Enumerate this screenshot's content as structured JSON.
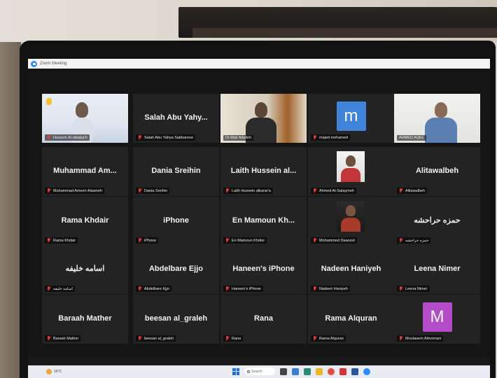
{
  "window": {
    "title": "Zoom Meeting"
  },
  "participants": [
    {
      "id": "p1",
      "label": "Hussein Al rababa'h",
      "video": true,
      "muted": true
    },
    {
      "id": "p2",
      "display": "Salah Abu Yahy...",
      "label": "Salah Abu Yahya Sabbarene",
      "muted": true
    },
    {
      "id": "p3",
      "label": "Dr.Wail Adaileh",
      "video": true,
      "muted": false
    },
    {
      "id": "p4",
      "initial": "m",
      "label": "majed mohamed",
      "muted": true,
      "avatar_color": "#3f84d9"
    },
    {
      "id": "p5",
      "label": "AHMED AQEL",
      "video": true,
      "muted": false,
      "active_speaker": true
    },
    {
      "id": "p6",
      "display": "Muhammad Am...",
      "label": "Muhammad Ameen Alawneh",
      "muted": true
    },
    {
      "id": "p7",
      "display": "Dania Sreihin",
      "label": "Dania Sreihin",
      "muted": true
    },
    {
      "id": "p8",
      "display": "Laith Hussein al...",
      "label": "Laith Hussein alkarar'a",
      "muted": true
    },
    {
      "id": "p9",
      "label": "Ahmed Al-Salaymeh",
      "photo": true,
      "muted": true
    },
    {
      "id": "p10",
      "display": "Alitawalbeh",
      "label": "Alitawalbeh",
      "muted": true
    },
    {
      "id": "p11",
      "display": "Rama Khdair",
      "label": "Rama Khdair",
      "muted": true
    },
    {
      "id": "p12",
      "display": "iPhone",
      "label": "iPhone",
      "muted": true
    },
    {
      "id": "p13",
      "display": "En Mamoun Kh...",
      "label": "En Mamoun Khdier",
      "muted": true
    },
    {
      "id": "p14",
      "label": "Mohammed Dawood",
      "photo": true,
      "muted": true
    },
    {
      "id": "p15",
      "display": "حمزه حراحشه",
      "label": "حمزه حراحشه",
      "muted": true
    },
    {
      "id": "p16",
      "display": "اسامه خليفه",
      "label": "اسامه خليفه",
      "muted": true
    },
    {
      "id": "p17",
      "display": "Abdelbare Ejjo",
      "label": "Abdelbare Ejjo",
      "muted": true
    },
    {
      "id": "p18",
      "display": "Haneen's iPhone",
      "label": "Haneen's iPhone",
      "muted": true
    },
    {
      "id": "p19",
      "display": "Nadeen Haniyeh",
      "label": "Nadeen Haniyeh",
      "muted": true
    },
    {
      "id": "p20",
      "display": "Leena Nimer",
      "label": "Leena Nimer",
      "muted": true
    },
    {
      "id": "p21",
      "display": "Baraah Mather",
      "label": "Baraah Mather",
      "muted": true
    },
    {
      "id": "p22",
      "display": "beesan al_graleh",
      "label": "beesan al_graleh",
      "muted": true
    },
    {
      "id": "p23",
      "display": "Rana",
      "label": "Rana",
      "muted": true
    },
    {
      "id": "p24",
      "display": "Rama Alquran",
      "label": "Rama Alquran",
      "muted": true
    },
    {
      "id": "p25",
      "initial": "M",
      "label": "Moutasem Almomani",
      "muted": true,
      "avatar_color": "#b54cc7"
    }
  ],
  "taskbar": {
    "weather": "16°C",
    "search_placeholder": "Search"
  },
  "colors": {
    "active_speaker": "#c8d34a",
    "mute": "#e23b3b"
  }
}
